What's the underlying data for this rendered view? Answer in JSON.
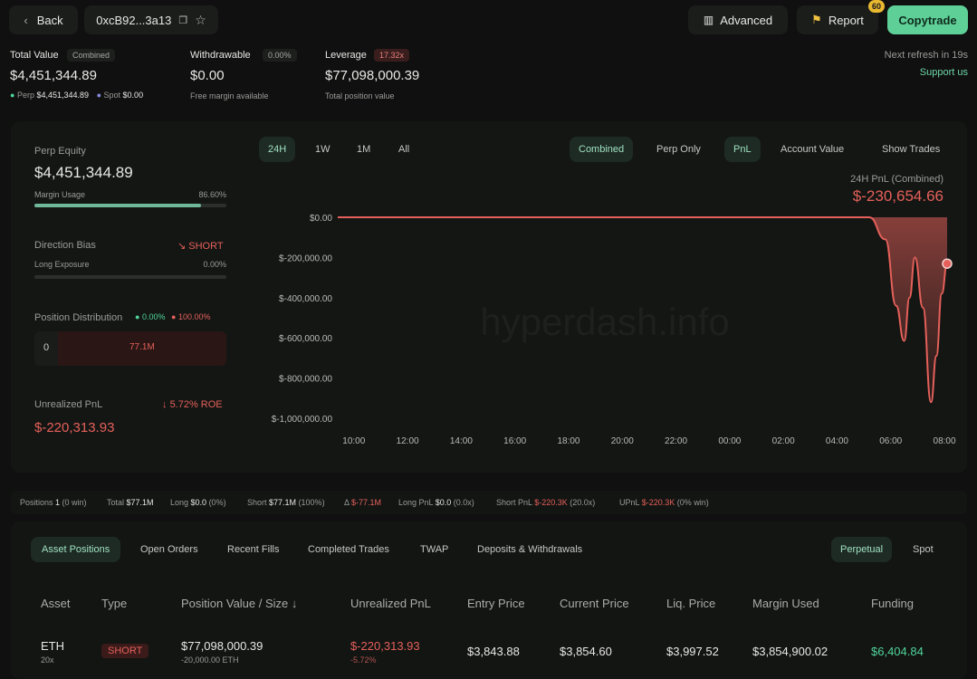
{
  "header": {
    "back_label": "Back",
    "address": "0xcB92...3a13",
    "advanced_label": "Advanced",
    "report_label": "Report",
    "report_badge": "60",
    "copytrade_label": "Copytrade",
    "refresh_text": "Next refresh in 19s",
    "support_text": "Support us"
  },
  "summary": {
    "total_value_label": "Total Value",
    "total_value_badge": "Combined",
    "total_value": "$4,451,344.89",
    "perp_label": "Perp",
    "perp_value": "$4,451,344.89",
    "spot_label": "Spot",
    "spot_value": "$0.00",
    "withdrawable_label": "Withdrawable",
    "withdrawable_pct": "0.00%",
    "withdrawable_value": "$0.00",
    "withdrawable_sub": "Free margin available",
    "leverage_label": "Leverage",
    "leverage_badge": "17.32x",
    "leverage_value": "$77,098,000.39",
    "leverage_sub": "Total position value"
  },
  "left_panel": {
    "perp_equity_label": "Perp Equity",
    "perp_equity_value": "$4,451,344.89",
    "margin_usage_label": "Margin Usage",
    "margin_usage_pct": "86.60%",
    "margin_usage_fraction": 0.866,
    "direction_bias_label": "Direction Bias",
    "direction_bias_value": "SHORT",
    "long_exposure_label": "Long Exposure",
    "long_exposure_pct": "0.00%",
    "position_dist_label": "Position Distribution",
    "dist_long_pct": "0.00%",
    "dist_short_pct": "100.00%",
    "dist_long_value": "0",
    "dist_short_value": "77.1M",
    "unrealized_label": "Unrealized PnL",
    "roe_value": "5.72% ROE",
    "unrealized_value": "$-220,313.93"
  },
  "chart_controls": {
    "ranges": [
      "24H",
      "1W",
      "1M",
      "All"
    ],
    "modes": [
      "Combined",
      "Perp Only"
    ],
    "metrics": [
      "PnL",
      "Account Value"
    ],
    "show_trades": "Show Trades",
    "chart_title": "24H PnL (Combined)",
    "chart_value": "$-230,654.66",
    "watermark": "hyperdash.info"
  },
  "chart_data": {
    "type": "area",
    "title": "24H PnL (Combined)",
    "y_ticks": [
      "$0.00",
      "$-200,000.00",
      "$-400,000.00",
      "$-600,000.00",
      "$-800,000.00",
      "$-1,000,000.00"
    ],
    "ylim": [
      -1000000,
      0
    ],
    "x_ticks": [
      "10:00",
      "12:00",
      "14:00",
      "16:00",
      "18:00",
      "20:00",
      "22:00",
      "00:00",
      "02:00",
      "04:00",
      "06:00",
      "08:00"
    ],
    "x_hours": [
      0,
      22.7
    ],
    "series": [
      {
        "x": [
          0,
          4,
          8,
          12,
          16,
          19.8,
          20.4,
          20.8,
          21.1,
          21.3,
          21.5,
          21.8,
          22.1,
          22.3,
          22.5,
          22.7
        ],
        "values": [
          0,
          0,
          0,
          0,
          0,
          0,
          -110000,
          -440000,
          -615000,
          -400000,
          -200000,
          -450000,
          -920000,
          -690000,
          -380000,
          -230654.66
        ]
      }
    ],
    "color": "#e5605a"
  },
  "stats_bar": [
    {
      "label": "Positions",
      "value": "1",
      "extra": "(0 win)"
    },
    {
      "label": "Total",
      "value": "$77.1M",
      "extra": ""
    },
    {
      "label": "Long",
      "value": "$0.0",
      "extra": "(0%)"
    },
    {
      "label": "Short",
      "value": "$77.1M",
      "extra": "(100%)"
    },
    {
      "label": "Δ",
      "value": "$-77.1M",
      "extra": ""
    },
    {
      "label": "Long PnL",
      "value": "$0.0",
      "extra": "(0.0x)"
    },
    {
      "label": "Short PnL",
      "value": "$-220.3K",
      "extra": "(20.0x)"
    },
    {
      "label": "UPnL",
      "value": "$-220.3K",
      "extra": "(0% win)"
    }
  ],
  "tabs": [
    "Asset Positions",
    "Open Orders",
    "Recent Fills",
    "Completed Trades",
    "TWAP",
    "Deposits & Withdrawals"
  ],
  "market_tabs": [
    "Perpetual",
    "Spot"
  ],
  "table": {
    "headers": [
      "Asset",
      "Type",
      "Position Value / Size",
      "Unrealized PnL",
      "Entry Price",
      "Current Price",
      "Liq. Price",
      "Margin Used",
      "Funding"
    ],
    "row": {
      "asset": "ETH",
      "leverage": "20x",
      "type": "SHORT",
      "position_value": "$77,098,000.39",
      "size": "-20,000.00 ETH",
      "pnl": "$-220,313.93",
      "pnl_pct": "-5.72%",
      "entry": "$3,843.88",
      "current": "$3,854.60",
      "liq": "$3,997.52",
      "margin": "$3,854,900.02",
      "funding": "$6,404.84"
    }
  }
}
